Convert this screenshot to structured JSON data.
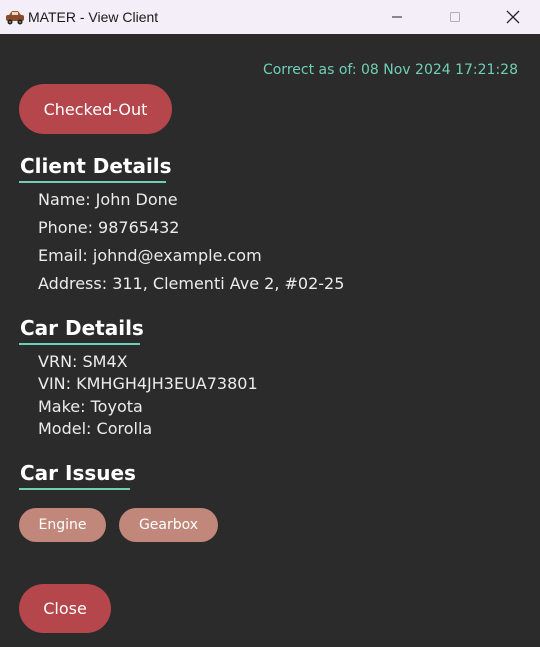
{
  "window": {
    "title": "MATER - View Client"
  },
  "header": {
    "timestamp": "Correct as of: 08 Nov 2024 17:21:28",
    "status_button_label": "Checked-Out"
  },
  "client_details": {
    "heading": "Client Details",
    "name": "Name: John Done",
    "phone": "Phone: 98765432",
    "email": "Email: johnd@example.com",
    "address": "Address: 311, Clementi Ave 2, #02-25"
  },
  "car_details": {
    "heading": "Car Details",
    "vrn": "VRN: SM4X",
    "vin": "VIN: KMHGH4JH3EUA73801",
    "make": "Make: Toyota",
    "model": "Model: Corolla"
  },
  "car_issues": {
    "heading": "Car Issues",
    "tags": [
      "Engine",
      "Gearbox"
    ]
  },
  "footer": {
    "close_label": "Close"
  },
  "colors": {
    "background": "#2b2b2b",
    "accent": "#6fcfb4",
    "button": "#b5464c",
    "tag": "#c0877a"
  }
}
